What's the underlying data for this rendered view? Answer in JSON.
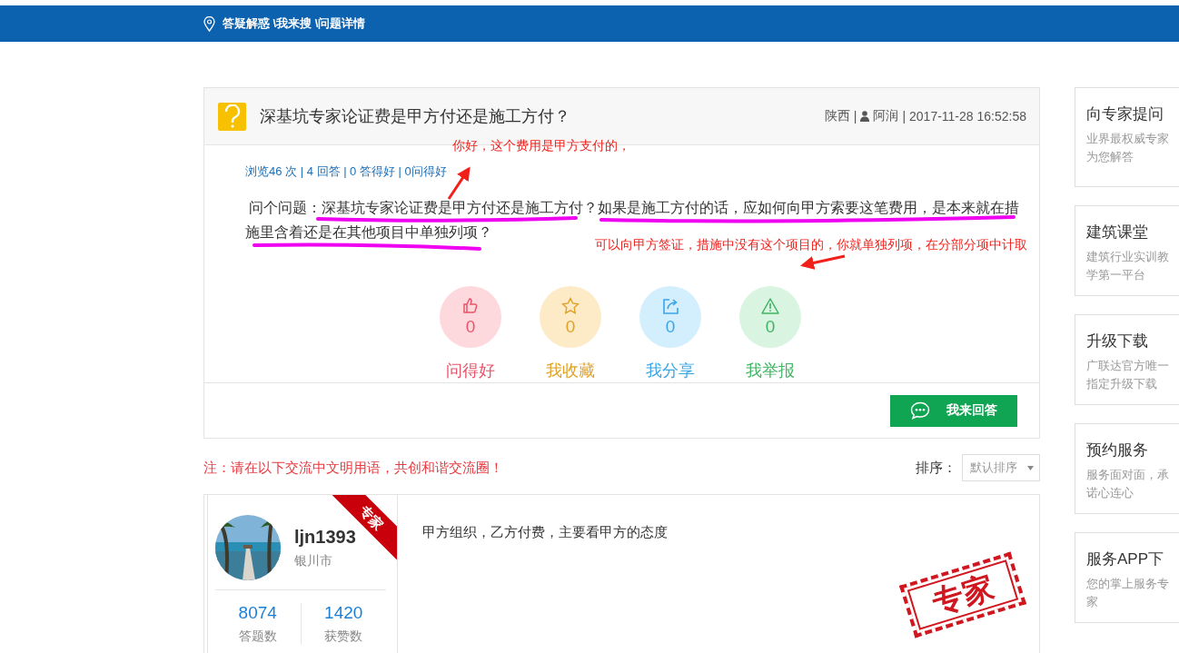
{
  "breadcrumb": "答疑解惑 \\我来搜 \\问题详情",
  "question": {
    "title": "深基坑专家论证费是甲方付还是施工方付？",
    "region": "陕西",
    "separator": "|",
    "author": "阿润",
    "time": "2017-11-28 16:52:58",
    "stats": "浏览46 次 | 4 回答 | 0 答得好 | 0问得好",
    "body_lines": [
      " 问个问题：深基坑专家论证费是甲方付还是施工方付？如果是施工方付的话，应如何向甲方索要这笔费用，是本来就在措",
      "施里含着还是在其他项目中单独列项？"
    ],
    "actions": [
      {
        "kind": "like",
        "count": "0",
        "label": "问得好"
      },
      {
        "kind": "collect",
        "count": "0",
        "label": "我收藏"
      },
      {
        "kind": "share",
        "count": "0",
        "label": "我分享"
      },
      {
        "kind": "report",
        "count": "0",
        "label": "我举报"
      }
    ],
    "answer_button": "我来回答"
  },
  "notice": "注：请在以下交流中文明用语，共创和谐交流圈！",
  "sort": {
    "label": "排序：",
    "value": "默认排序"
  },
  "answers": [
    {
      "name": "ljn1393",
      "city": "银川市",
      "badge": "专家",
      "text": "甲方组织，乙方付费，主要看甲方的态度",
      "stamp": "专家",
      "stats": [
        {
          "value": "8074",
          "label": "答题数"
        },
        {
          "value": "1420",
          "label": "获赞数"
        }
      ]
    }
  ],
  "sidebar": [
    {
      "title": "向专家提问",
      "subtitle": "业界最权威专家为您解答"
    },
    {
      "title": "建筑课堂",
      "subtitle": "建筑行业实训教学第一平台"
    },
    {
      "title": "升级下载",
      "subtitle": "广联达官方唯一指定升级下载"
    },
    {
      "title": "预约服务",
      "subtitle": "服务面对面，承诺心连心"
    },
    {
      "title": "服务APP下",
      "subtitle": "您的掌上服务专家"
    }
  ],
  "annotations": [
    {
      "text": "你好，这个费用是甲方支付的，"
    },
    {
      "text": "可以向甲方签证，措施中没有这个项目的，你就单独列项，在分部分项中计取"
    }
  ]
}
